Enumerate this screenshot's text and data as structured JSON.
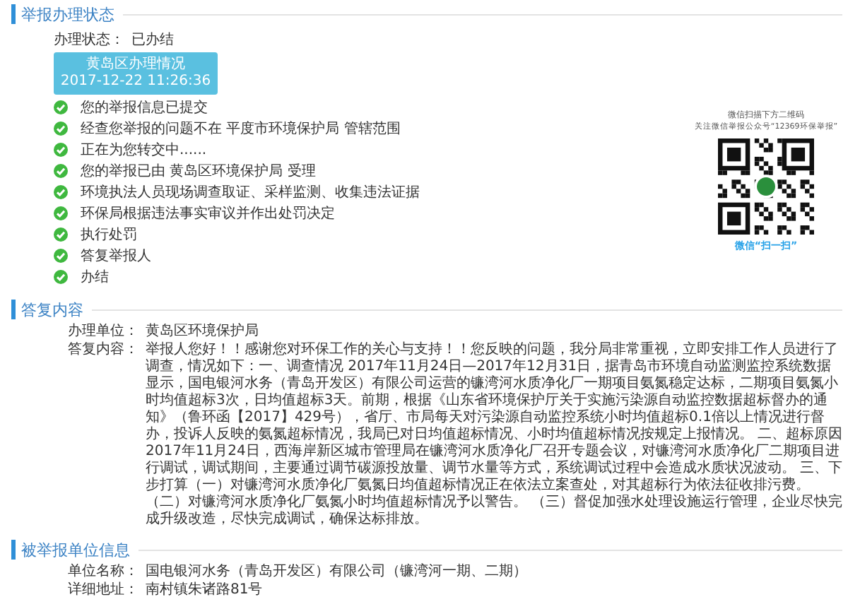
{
  "status_section": {
    "title": "举报办理状态",
    "status_label": "办理状态：",
    "status_value": "已办结",
    "stage_box": {
      "title": "黄岛区办理情况",
      "time": "2017-12-22 11:26:36"
    },
    "steps": [
      {
        "text": "您的举报信息已提交",
        "done": true
      },
      {
        "text": "经查您举报的问题不在 平度市环境保护局 管辖范围",
        "done": true
      },
      {
        "text": "正在为您转交中......",
        "done": true
      },
      {
        "text": "您的举报已由 黄岛区环境保护局 受理",
        "done": true
      },
      {
        "text": "环境执法人员现场调查取证、采样监测、收集违法证据",
        "done": true
      },
      {
        "text": "环保局根据违法事实审议并作出处罚决定",
        "done": true
      },
      {
        "text": "执行处罚",
        "done": true
      },
      {
        "text": "答复举报人",
        "done": true
      },
      {
        "text": "办结",
        "done": true
      }
    ],
    "qr": {
      "line1": "微信扫描下方二维码",
      "line2": "关注微信举报公众号“12369环保举报”",
      "caption": "微信“扫一扫”"
    }
  },
  "reply_section": {
    "title": "答复内容",
    "fields": [
      {
        "label": "办理单位：",
        "value": "黄岛区环境保护局"
      },
      {
        "label": "答复内容：",
        "value": "举报人您好！！感谢您对环保工作的关心与支持！！您反映的问题，我分局非常重视，立即安排工作人员进行了调查，情况如下：一、调查情况 2017年11月24日—2017年12月31日，据青岛市环境自动监测监控系统数据显示，国电银河水务（青岛开发区）有限公司运营的镰湾河水质净化厂一期项目氨氮稳定达标，二期项目氨氮小时均值超标3次，日均值超标3天。前期，根据《山东省环境保护厅关于实施污染源自动监控数据超标督办的通知》（鲁环函【2017】429号），省厅、市局每天对污染源自动监控系统小时均值超标0.1倍以上情况进行督办，投诉人反映的氨氮超标情况，我局已对日均值超标情况、小时均值超标情况按规定上报情况。 二、超标原因 2017年11月24日，西海岸新区城市管理局在镰湾河水质净化厂召开专题会议，对镰湾河水质净化厂二期项目进行调试，调试期间，主要通过调节碳源投放量、调节水量等方式，系统调试过程中会造成水质状况波动。 三、下步打算（一）对镰湾河水质净化厂氨氮日均值超标情况正在依法立案查处，对其超标行为依法征收排污费。（二）对镰湾河水质净化厂氨氮小时均值超标情况予以警告。 （三）督促加强水处理设施运行管理，企业尽快完成升级改造，尽快完成调试，确保达标排放。"
      }
    ]
  },
  "unit_section": {
    "title": "被举报单位信息",
    "fields": [
      {
        "label": "单位名称：",
        "value": "国电银河水务（青岛开发区）有限公司（镰湾河一期、二期）"
      },
      {
        "label": "详细地址：",
        "value": "南村镇朱诸路81号"
      }
    ]
  }
}
